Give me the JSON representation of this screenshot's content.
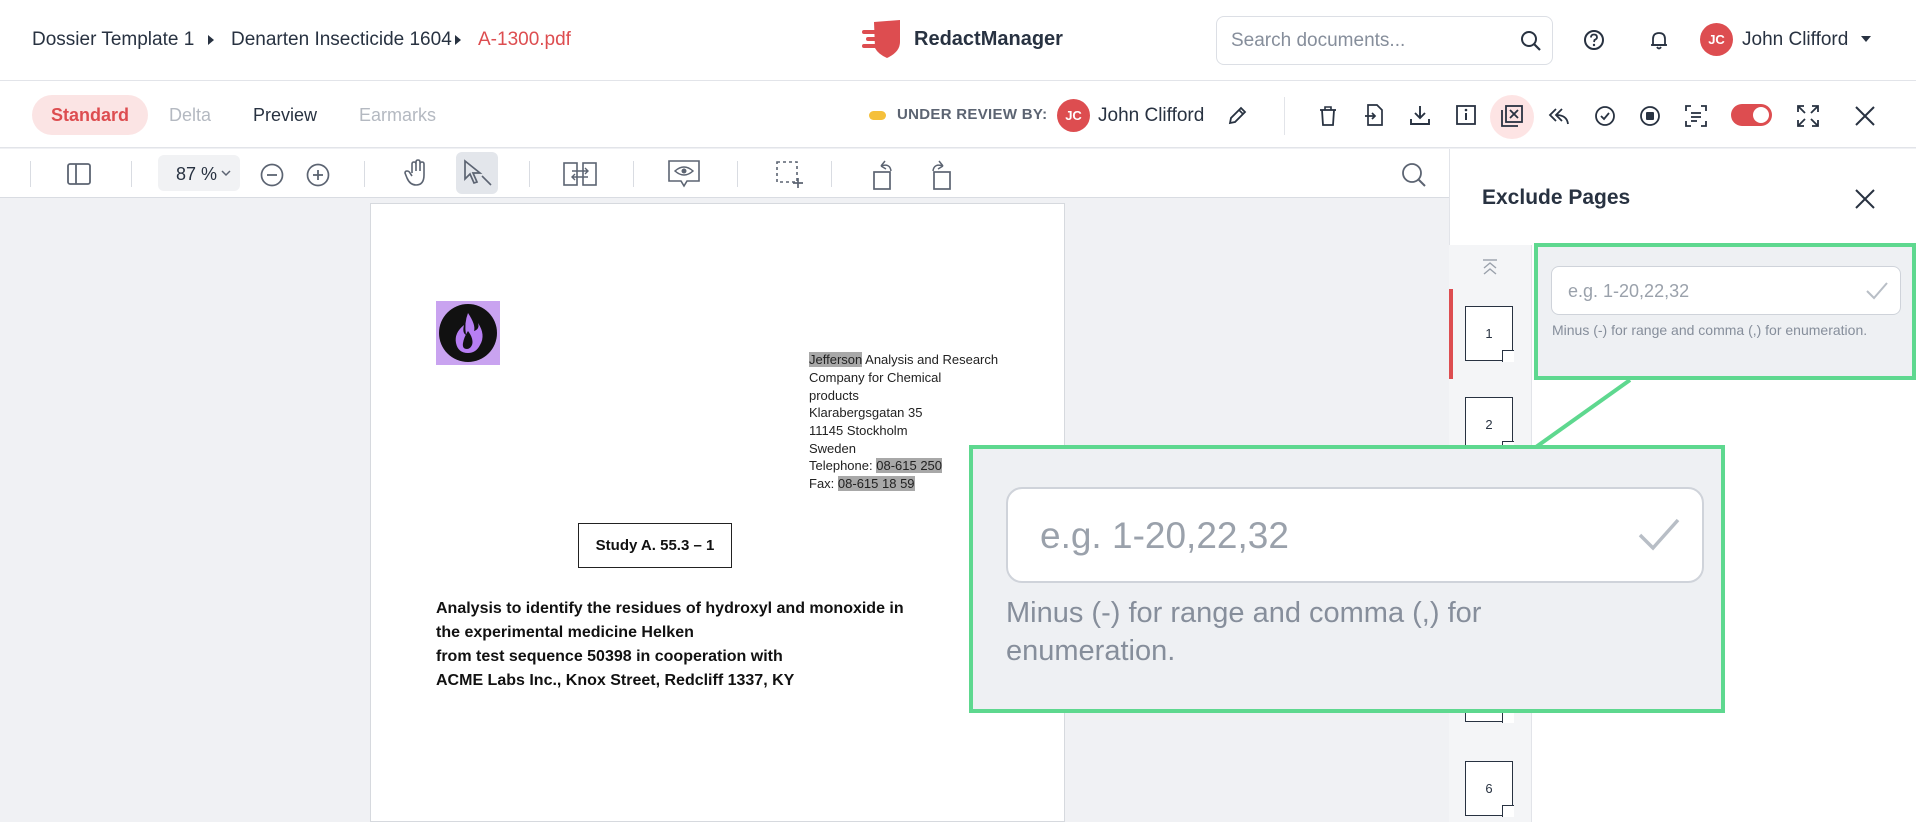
{
  "breadcrumb": {
    "items": [
      "Dossier Template 1",
      "Denarten Insecticide 1604",
      "A-1300.pdf"
    ]
  },
  "app": {
    "name": "RedactManager"
  },
  "search": {
    "placeholder": "Search documents..."
  },
  "user": {
    "initials": "JC",
    "name": "John Clifford"
  },
  "view_tabs": [
    {
      "label": "Standard",
      "state": "active"
    },
    {
      "label": "Delta",
      "state": "disabled"
    },
    {
      "label": "Preview",
      "state": "normal"
    },
    {
      "label": "Earmarks",
      "state": "disabled"
    }
  ],
  "status": {
    "label": "UNDER REVIEW BY:",
    "reviewer_initials": "JC",
    "reviewer_name": "John Clifford"
  },
  "viewer": {
    "zoom": "87 %"
  },
  "document": {
    "address": {
      "line1_hl": "Jefferson",
      "line1_rest": " Analysis and Research",
      "line2": "Company for Chemical",
      "line3": "products",
      "line4": "Klarabergsgatan 35",
      "line5": "11145 Stockholm",
      "line6": "Sweden",
      "tel_label": "Telephone: ",
      "tel_value": "08-615 250",
      "fax_label": "Fax: ",
      "fax_value": "08-615 18 59"
    },
    "study": "Study A. 55.3 – 1",
    "analysis": [
      "Analysis to identify the residues of hydroxyl and monoxide in",
      "the experimental medicine Helken",
      "from test sequence 50398 in cooperation with",
      "ACME Labs Inc., Knox Street, Redcliff 1337, KY"
    ]
  },
  "panel": {
    "title": "Exclude Pages",
    "range_placeholder": "e.g. 1-20,22,32",
    "range_hint": "Minus (-) for range and comma (,) for enumeration.",
    "thumbnails": [
      "1",
      "2",
      "6"
    ]
  },
  "colors": {
    "accent": "#dd4d50",
    "highlight": "#5ed88f",
    "status": "#f5c03b"
  }
}
